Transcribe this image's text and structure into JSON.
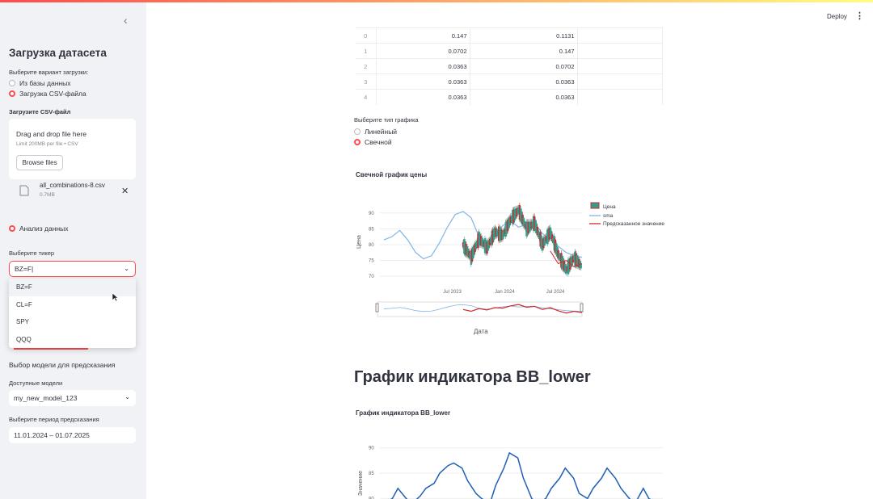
{
  "sidebar": {
    "title": "Загрузка датасета",
    "load_prompt": "Выберите вариант загрузки:",
    "load_options": [
      "Из базы данных",
      "Загрузка CSV-файла"
    ],
    "upload_label": "Загрузите CSV-файл",
    "dropzone_text": "Drag and drop file here",
    "dropzone_limit": "Limit 200MB per file • CSV",
    "browse_label": "Browse files",
    "file_name": "all_combinations-8.csv",
    "file_size": "0.7MB",
    "analysis_label": "Анализ данных",
    "ticker_label": "Выберите тикер",
    "ticker_value": "BZ=F",
    "ticker_options": [
      "BZ=F",
      "CL=F",
      "SPY",
      "QQQ"
    ],
    "model_section": "Выбор модели для предсказания",
    "models_label": "Доступные модели",
    "model_value": "my_new_model_123",
    "period_label": "Выберите период предсказания",
    "period_value": "11.01.2024 – 01.07.2025"
  },
  "header": {
    "deploy": "Deploy"
  },
  "table": {
    "rows": [
      {
        "idx": "0",
        "a": "0.147",
        "b": "0.1131"
      },
      {
        "idx": "1",
        "a": "0.0702",
        "b": "0.147"
      },
      {
        "idx": "2",
        "a": "0.0363",
        "b": "0.0702"
      },
      {
        "idx": "3",
        "a": "0.0363",
        "b": "0.0363"
      },
      {
        "idx": "4",
        "a": "0.0363",
        "b": "0.0363"
      }
    ]
  },
  "chart_type": {
    "label": "Выберите тип графика",
    "options": [
      "Линейный",
      "Свечной"
    ],
    "selected": "Свечной"
  },
  "colors": {
    "accent": "#ff4b4b",
    "sma": "#7fb4e6",
    "bb": "#1f5fb5",
    "up": "#2e9e8f",
    "down": "#d62728"
  },
  "chart_data": [
    {
      "type": "line",
      "title": "Свечной график цены",
      "ylabel": "Цена",
      "xlabel": "Дата",
      "ylim": [
        68,
        93
      ],
      "yticks": [
        "90",
        "85",
        "80",
        "75",
        "70"
      ],
      "xticks": [
        "Jul 2023",
        "Jan 2024",
        "Jul 2024"
      ],
      "legend": [
        "Цена",
        "sma",
        "Предсказанное значение"
      ],
      "series": [
        {
          "name": "sma",
          "x": [
            0,
            4,
            8,
            12,
            16,
            20,
            24,
            28,
            32,
            36,
            40,
            44,
            48,
            52,
            56,
            60,
            64,
            68,
            72,
            76,
            80,
            84,
            88,
            92,
            96,
            100
          ],
          "values": [
            81.5,
            82.5,
            84.5,
            81.5,
            77.5,
            75.5,
            76.5,
            80.5,
            85.5,
            89.5,
            90.5,
            88.5,
            82.5,
            80.5,
            83.5,
            86,
            87.5,
            85.5,
            86.5,
            87,
            83.5,
            81.5,
            79.5,
            77.5,
            76.5,
            76
          ]
        },
        {
          "name": "Цена",
          "x": [
            40,
            44,
            48,
            52,
            56,
            60,
            64,
            68,
            72,
            76,
            80,
            84,
            88,
            92,
            96,
            100
          ],
          "values": [
            80,
            76,
            82,
            79,
            84,
            83,
            88,
            91,
            85,
            87,
            80,
            84,
            77,
            72,
            76,
            73
          ]
        },
        {
          "name": "Предсказанное значение",
          "x": [
            84,
            88,
            92,
            96,
            100
          ],
          "values": [
            78,
            74,
            75,
            73,
            74
          ]
        }
      ]
    },
    {
      "type": "line",
      "title": "График индикатора BB_lower",
      "ylabel": "Значение",
      "ylim": [
        78,
        92
      ],
      "yticks": [
        "90",
        "85",
        "80"
      ],
      "series": [
        {
          "name": "BB_lower",
          "x": [
            0,
            3,
            5,
            8,
            10,
            13,
            15,
            18,
            20,
            23,
            25,
            28,
            30,
            33,
            35,
            38,
            40,
            43,
            45,
            48,
            50,
            53,
            55,
            58,
            60,
            63,
            65,
            68,
            70,
            73,
            75,
            78,
            80,
            83,
            85,
            88,
            90,
            93,
            95,
            98,
            100
          ],
          "values": [
            79,
            80,
            82,
            80,
            79,
            80.5,
            82,
            83,
            85,
            86.5,
            87,
            86,
            83.5,
            81,
            80,
            79,
            82.5,
            86,
            89,
            88,
            84,
            80,
            79,
            80,
            82,
            84,
            86,
            84,
            81,
            80,
            82,
            84,
            86,
            84,
            82,
            80,
            79,
            82,
            80,
            79,
            78.5
          ]
        }
      ]
    }
  ],
  "headings": {
    "bb": "График индикатора BB_lower"
  }
}
